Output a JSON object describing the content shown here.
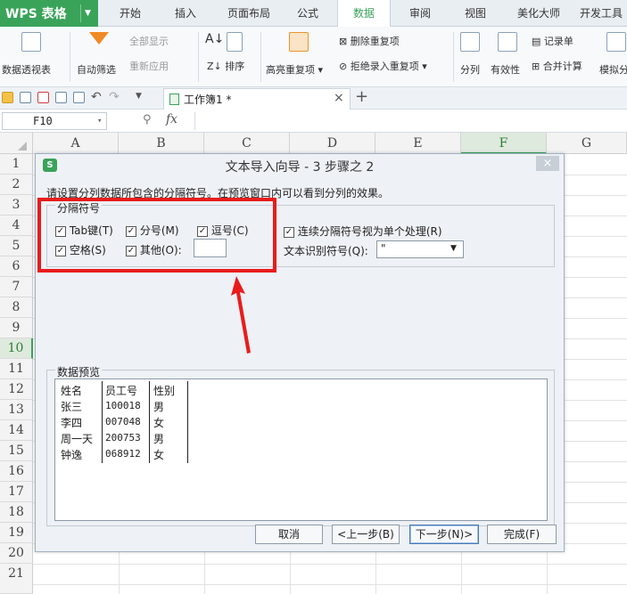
{
  "app": {
    "name": "WPS 表格"
  },
  "menu_tabs": [
    "开始",
    "插入",
    "页面布局",
    "公式",
    "数据",
    "审阅",
    "视图",
    "美化大师",
    "开发工具"
  ],
  "active_tab": "数据",
  "ribbon": {
    "pivot": "数据透视表",
    "autofilter": "自动筛选",
    "show_all": "全部显示",
    "reapply": "重新应用",
    "sort": "排序",
    "highlight_dup": "高亮重复项",
    "remove_dup": "删除重复项",
    "reject_dup": "拒绝录入重复项",
    "split": "分列",
    "validity": "有效性",
    "record": "记录单",
    "merge_calc": "合并计算",
    "simulate": "模拟分"
  },
  "document_tab": {
    "title": "工作簿1 *"
  },
  "formula_bar": {
    "cell_ref": "F10",
    "fx": "fx"
  },
  "columns": [
    "A",
    "B",
    "C",
    "D",
    "E",
    "F",
    "G"
  ],
  "selected_column": "F",
  "rows": [
    "1",
    "2",
    "3",
    "4",
    "5",
    "6",
    "7",
    "8",
    "9",
    "10",
    "11",
    "12",
    "13",
    "14",
    "15",
    "16",
    "17",
    "18",
    "19",
    "20",
    "21"
  ],
  "selected_row": "10",
  "dialog": {
    "title": "文本导入向导 - 3 步骤之 2",
    "close": "×",
    "instruction": "请设置分列数据所包含的分隔符号。在预览窗口内可以看到分列的效果。",
    "group_label": "分隔符号",
    "delimiters": {
      "tab": {
        "label": "Tab键(T)",
        "checked": true
      },
      "semicolon": {
        "label": "分号(M)",
        "checked": true
      },
      "comma": {
        "label": "逗号(C)",
        "checked": true
      },
      "space": {
        "label": "空格(S)",
        "checked": true
      },
      "other": {
        "label": "其他(O):",
        "checked": true,
        "value": ""
      }
    },
    "consecutive": {
      "label": "连续分隔符号视为单个处理(R)",
      "checked": true
    },
    "text_qualifier": {
      "label": "文本识别符号(Q):",
      "value": "\""
    },
    "preview_label": "数据预览",
    "preview_rows": [
      [
        "姓名",
        "员工号",
        "性别"
      ],
      [
        "张三",
        "100018",
        "男"
      ],
      [
        "李四",
        "007048",
        "女"
      ],
      [
        "周一天",
        "200753",
        "男"
      ],
      [
        "钟逸",
        "068912",
        "女"
      ]
    ],
    "buttons": {
      "cancel": "取消",
      "back": "<上一步(B)",
      "next": "下一步(N)>",
      "finish": "完成(F)"
    }
  },
  "colors": {
    "accent_green": "#3aa35a",
    "highlight_red": "#e81c1c"
  }
}
